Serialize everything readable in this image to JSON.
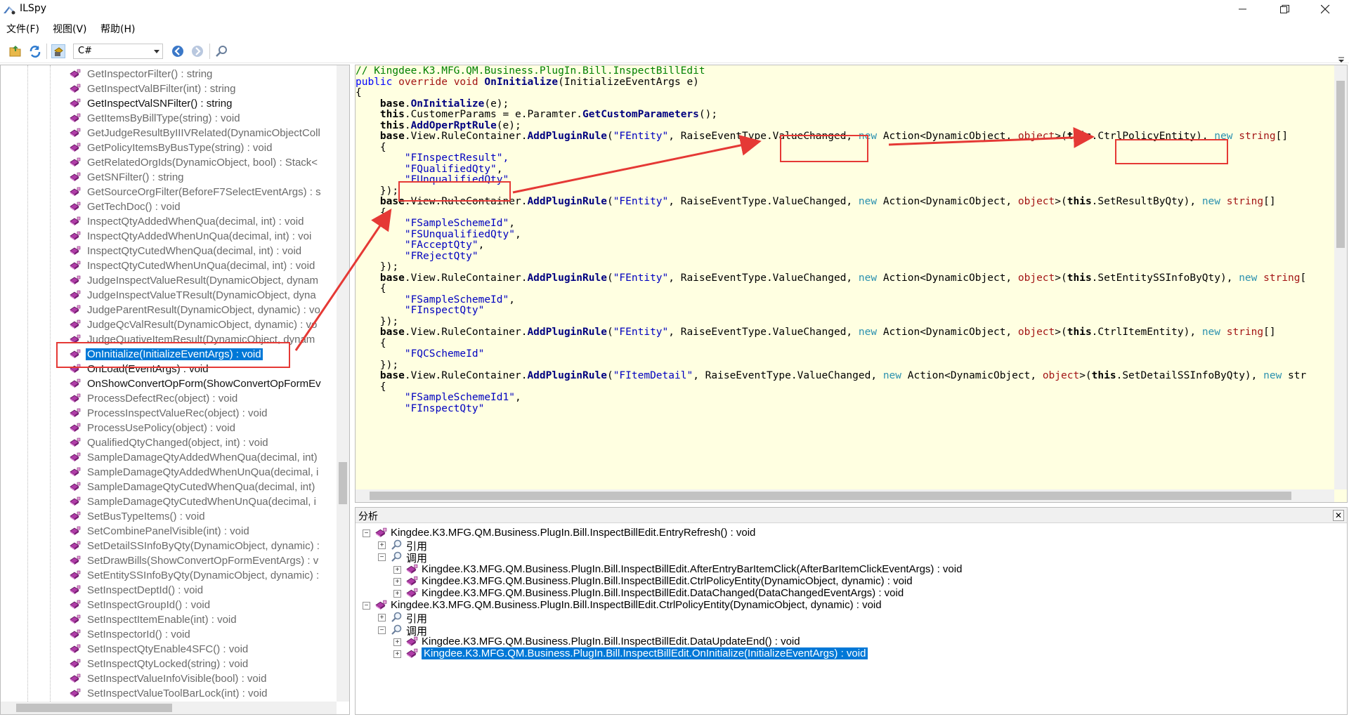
{
  "window": {
    "title": "ILSpy",
    "minimize_icon": "minimize-icon",
    "maximize_icon": "restore-icon",
    "close_icon": "close-icon"
  },
  "menu": {
    "items": [
      {
        "label": "文件(F)"
      },
      {
        "label": "视图(V)"
      },
      {
        "label": "帮助(H)"
      }
    ]
  },
  "toolbar": {
    "buttons": [
      "open-icon",
      "refresh-icon",
      "assembly-list-icon",
      "back-icon",
      "forward-icon",
      "search-icon"
    ],
    "language": "C#"
  },
  "tree": {
    "items": [
      {
        "label": "GetInspectorFilter() : string"
      },
      {
        "label": "GetInspectValBFilter(int) : string"
      },
      {
        "label": "GetInspectValSNFilter() : string",
        "dark": true
      },
      {
        "label": "GetItemsByBillType(string) : void"
      },
      {
        "label": "GetJudgeResultByIIIVRelated(DynamicObjectColl"
      },
      {
        "label": "GetPolicyItemsByBusType(string) : void"
      },
      {
        "label": "GetRelatedOrgIds(DynamicObject, bool) : Stack<"
      },
      {
        "label": "GetSNFilter() : string"
      },
      {
        "label": "GetSourceOrgFilter(BeforeF7SelectEventArgs) : s"
      },
      {
        "label": "GetTechDoc() : void"
      },
      {
        "label": "InspectQtyAddedWhenQua(decimal, int) : void"
      },
      {
        "label": "InspectQtyAddedWhenUnQua(decimal, int) : voi"
      },
      {
        "label": "InspectQtyCutedWhenQua(decimal, int) : void"
      },
      {
        "label": "InspectQtyCutedWhenUnQua(decimal, int) : void"
      },
      {
        "label": "JudgeInspectValueResult(DynamicObject, dynam"
      },
      {
        "label": "JudgeInspectValueTResult(DynamicObject, dyna"
      },
      {
        "label": "JudgeParentResult(DynamicObject, dynamic) : vo"
      },
      {
        "label": "JudgeQcValResult(DynamicObject, dynamic) : vo"
      },
      {
        "label": "JudgeQuativeItemResult(DynamicObject, dynam"
      },
      {
        "label": "OnInitialize(InitializeEventArgs) : void",
        "selected": true
      },
      {
        "label": "OnLoad(EventArgs) : void",
        "dark": true
      },
      {
        "label": "OnShowConvertOpForm(ShowConvertOpFormEv",
        "dark": true
      },
      {
        "label": "ProcessDefectRec(object) : void"
      },
      {
        "label": "ProcessInspectValueRec(object) : void"
      },
      {
        "label": "ProcessUsePolicy(object) : void"
      },
      {
        "label": "QualifiedQtyChanged(object, int) : void"
      },
      {
        "label": "SampleDamageQtyAddedWhenQua(decimal, int)"
      },
      {
        "label": "SampleDamageQtyAddedWhenUnQua(decimal, i"
      },
      {
        "label": "SampleDamageQtyCutedWhenQua(decimal, int)"
      },
      {
        "label": "SampleDamageQtyCutedWhenUnQua(decimal, i"
      },
      {
        "label": "SetBusTypeItems() : void"
      },
      {
        "label": "SetCombinePanelVisible(int) : void"
      },
      {
        "label": "SetDetailSSInfoByQty(DynamicObject, dynamic) :"
      },
      {
        "label": "SetDrawBills(ShowConvertOpFormEventArgs) : v"
      },
      {
        "label": "SetEntitySSInfoByQty(DynamicObject, dynamic) :"
      },
      {
        "label": "SetInspectDeptId() : void"
      },
      {
        "label": "SetInspectGroupId() : void"
      },
      {
        "label": "SetInspectItemEnable(int) : void"
      },
      {
        "label": "SetInspectorId() : void"
      },
      {
        "label": "SetInspectQtyEnable4SFC() : void"
      },
      {
        "label": "SetInspectQtyLocked(string) : void"
      },
      {
        "label": "SetInspectValueInfoVisible(bool) : void"
      },
      {
        "label": "SetInspectValueToolBarLock(int) : void"
      }
    ]
  },
  "code": {
    "lines": [
      [
        {
          "t": "// Kingdee.K3.MFG.QM.Business.PlugIn.Bill.InspectBillEdit",
          "c": "cm"
        }
      ],
      [
        {
          "t": "public",
          "c": "kw"
        },
        {
          "t": " "
        },
        {
          "t": "override",
          "c": "ko"
        },
        {
          "t": " "
        },
        {
          "t": "void",
          "c": "ko"
        },
        {
          "t": " "
        },
        {
          "t": "OnInitialize",
          "c": "fn"
        },
        {
          "t": "(InitializeEventArgs e)"
        }
      ],
      [
        {
          "t": "{"
        }
      ],
      [
        {
          "t": "    "
        },
        {
          "t": "base",
          "c": "kwb"
        },
        {
          "t": "."
        },
        {
          "t": "OnInitialize",
          "c": "fn"
        },
        {
          "t": "(e);"
        }
      ],
      [
        {
          "t": "    "
        },
        {
          "t": "this",
          "c": "kwb"
        },
        {
          "t": ".CustomerParams = e.Paramter."
        },
        {
          "t": "GetCustomParameters",
          "c": "fn"
        },
        {
          "t": "();"
        }
      ],
      [
        {
          "t": "    "
        },
        {
          "t": "this",
          "c": "kwb"
        },
        {
          "t": "."
        },
        {
          "t": "AddOperRptRule",
          "c": "fn"
        },
        {
          "t": "(e);"
        }
      ],
      [
        {
          "t": "    "
        },
        {
          "t": "base",
          "c": "kwb"
        },
        {
          "t": ".View.RuleContainer."
        },
        {
          "t": "AddPluginRule",
          "c": "fn"
        },
        {
          "t": "("
        },
        {
          "t": "\"FEntity\"",
          "c": "st"
        },
        {
          "t": ", RaiseEventType.ValueChanged, "
        },
        {
          "t": "new",
          "c": "kt"
        },
        {
          "t": " Action<DynamicObject, "
        },
        {
          "t": "object",
          "c": "ko"
        },
        {
          "t": ">("
        },
        {
          "t": "this",
          "c": "kwb"
        },
        {
          "t": ".CtrlPolicyEntity), "
        },
        {
          "t": "new",
          "c": "kt"
        },
        {
          "t": " "
        },
        {
          "t": "string",
          "c": "ko"
        },
        {
          "t": "[]"
        }
      ],
      [
        {
          "t": "    {"
        }
      ],
      [
        {
          "t": "        "
        },
        {
          "t": "\"FInspectResult\",",
          "c": "st"
        }
      ],
      [
        {
          "t": "        "
        },
        {
          "t": "\"FQualifiedQty\"",
          "c": "st"
        },
        {
          "t": ","
        }
      ],
      [
        {
          "t": "        "
        },
        {
          "t": "\"FUnqualifiedQty\"",
          "c": "st"
        }
      ],
      [
        {
          "t": "    });"
        }
      ],
      [
        {
          "t": "    "
        },
        {
          "t": "base",
          "c": "kwb"
        },
        {
          "t": ".View.RuleContainer."
        },
        {
          "t": "AddPluginRule",
          "c": "fn"
        },
        {
          "t": "("
        },
        {
          "t": "\"FEntity\"",
          "c": "st"
        },
        {
          "t": ", RaiseEventType.ValueChanged, "
        },
        {
          "t": "new",
          "c": "kt"
        },
        {
          "t": " Action<DynamicObject, "
        },
        {
          "t": "object",
          "c": "ko"
        },
        {
          "t": ">("
        },
        {
          "t": "this",
          "c": "kwb"
        },
        {
          "t": ".SetResultByQty), "
        },
        {
          "t": "new",
          "c": "kt"
        },
        {
          "t": " "
        },
        {
          "t": "string",
          "c": "ko"
        },
        {
          "t": "[]"
        }
      ],
      [
        {
          "t": "    {"
        }
      ],
      [
        {
          "t": "        "
        },
        {
          "t": "\"FSampleSchemeId\"",
          "c": "st"
        },
        {
          "t": ","
        }
      ],
      [
        {
          "t": "        "
        },
        {
          "t": "\"FSUnqualifiedQty\"",
          "c": "st"
        },
        {
          "t": ","
        }
      ],
      [
        {
          "t": "        "
        },
        {
          "t": "\"FAcceptQty\"",
          "c": "st"
        },
        {
          "t": ","
        }
      ],
      [
        {
          "t": "        "
        },
        {
          "t": "\"FRejectQty\"",
          "c": "st"
        }
      ],
      [
        {
          "t": "    });"
        }
      ],
      [
        {
          "t": "    "
        },
        {
          "t": "base",
          "c": "kwb"
        },
        {
          "t": ".View.RuleContainer."
        },
        {
          "t": "AddPluginRule",
          "c": "fn"
        },
        {
          "t": "("
        },
        {
          "t": "\"FEntity\"",
          "c": "st"
        },
        {
          "t": ", RaiseEventType.ValueChanged, "
        },
        {
          "t": "new",
          "c": "kt"
        },
        {
          "t": " Action<DynamicObject, "
        },
        {
          "t": "object",
          "c": "ko"
        },
        {
          "t": ">("
        },
        {
          "t": "this",
          "c": "kwb"
        },
        {
          "t": ".SetEntitySSInfoByQty), "
        },
        {
          "t": "new",
          "c": "kt"
        },
        {
          "t": " "
        },
        {
          "t": "string",
          "c": "ko"
        },
        {
          "t": "["
        }
      ],
      [
        {
          "t": "    {"
        }
      ],
      [
        {
          "t": "        "
        },
        {
          "t": "\"FSampleSchemeId\"",
          "c": "st"
        },
        {
          "t": ","
        }
      ],
      [
        {
          "t": "        "
        },
        {
          "t": "\"FInspectQty\"",
          "c": "st"
        }
      ],
      [
        {
          "t": "    });"
        }
      ],
      [
        {
          "t": "    "
        },
        {
          "t": "base",
          "c": "kwb"
        },
        {
          "t": ".View.RuleContainer."
        },
        {
          "t": "AddPluginRule",
          "c": "fn"
        },
        {
          "t": "("
        },
        {
          "t": "\"FEntity\"",
          "c": "st"
        },
        {
          "t": ", RaiseEventType.ValueChanged, "
        },
        {
          "t": "new",
          "c": "kt"
        },
        {
          "t": " Action<DynamicObject, "
        },
        {
          "t": "object",
          "c": "ko"
        },
        {
          "t": ">("
        },
        {
          "t": "this",
          "c": "kwb"
        },
        {
          "t": ".CtrlItemEntity), "
        },
        {
          "t": "new",
          "c": "kt"
        },
        {
          "t": " "
        },
        {
          "t": "string",
          "c": "ko"
        },
        {
          "t": "[]"
        }
      ],
      [
        {
          "t": "    {"
        }
      ],
      [
        {
          "t": "        "
        },
        {
          "t": "\"FQCSchemeId\"",
          "c": "st"
        }
      ],
      [
        {
          "t": "    });"
        }
      ],
      [
        {
          "t": "    "
        },
        {
          "t": "base",
          "c": "kwb"
        },
        {
          "t": ".View.RuleContainer."
        },
        {
          "t": "AddPluginRule",
          "c": "fn"
        },
        {
          "t": "("
        },
        {
          "t": "\"FItemDetail\"",
          "c": "st"
        },
        {
          "t": ", RaiseEventType.ValueChanged, "
        },
        {
          "t": "new",
          "c": "kt"
        },
        {
          "t": " Action<DynamicObject, "
        },
        {
          "t": "object",
          "c": "ko"
        },
        {
          "t": ">("
        },
        {
          "t": "this",
          "c": "kwb"
        },
        {
          "t": ".SetDetailSSInfoByQty), "
        },
        {
          "t": "new",
          "c": "kt"
        },
        {
          "t": " str"
        }
      ],
      [
        {
          "t": "    {"
        }
      ],
      [
        {
          "t": "        "
        },
        {
          "t": "\"FSampleSchemeId1\"",
          "c": "st"
        },
        {
          "t": ","
        }
      ],
      [
        {
          "t": "        "
        },
        {
          "t": "\"FInspectQty\"",
          "c": "st"
        }
      ]
    ]
  },
  "analysis": {
    "title": "分析",
    "rows": [
      {
        "level": 0,
        "expander": "−",
        "icon": "method-icon",
        "label": "Kingdee.K3.MFG.QM.Business.PlugIn.Bill.InspectBillEdit.EntryRefresh() : void"
      },
      {
        "level": 1,
        "expander": "+",
        "icon": "search-icon",
        "label": "引用"
      },
      {
        "level": 1,
        "expander": "−",
        "icon": "search-icon",
        "label": "调用"
      },
      {
        "level": 2,
        "expander": "+",
        "icon": "method-icon",
        "label": "Kingdee.K3.MFG.QM.Business.PlugIn.Bill.InspectBillEdit.AfterEntryBarItemClick(AfterBarItemClickEventArgs) : void"
      },
      {
        "level": 2,
        "expander": "+",
        "icon": "method-icon",
        "label": "Kingdee.K3.MFG.QM.Business.PlugIn.Bill.InspectBillEdit.CtrlPolicyEntity(DynamicObject, dynamic) : void"
      },
      {
        "level": 2,
        "expander": "+",
        "icon": "method-icon",
        "label": "Kingdee.K3.MFG.QM.Business.PlugIn.Bill.InspectBillEdit.DataChanged(DataChangedEventArgs) : void"
      },
      {
        "level": 0,
        "expander": "−",
        "icon": "method-icon",
        "label": "Kingdee.K3.MFG.QM.Business.PlugIn.Bill.InspectBillEdit.CtrlPolicyEntity(DynamicObject, dynamic) : void"
      },
      {
        "level": 1,
        "expander": "+",
        "icon": "search-icon",
        "label": "引用"
      },
      {
        "level": 1,
        "expander": "−",
        "icon": "search-icon",
        "label": "调用"
      },
      {
        "level": 2,
        "expander": "+",
        "icon": "method-icon",
        "label": "Kingdee.K3.MFG.QM.Business.PlugIn.Bill.InspectBillEdit.DataUpdateEnd() : void"
      },
      {
        "level": 2,
        "expander": "+",
        "icon": "method-icon",
        "label": "Kingdee.K3.MFG.QM.Business.PlugIn.Bill.InspectBillEdit.OnInitialize(InitializeEventArgs) : void",
        "selected": true
      }
    ]
  },
  "colors": {
    "code_bg": "#ffffe1",
    "selection": "#0078d7",
    "annotation": "#e53935"
  }
}
